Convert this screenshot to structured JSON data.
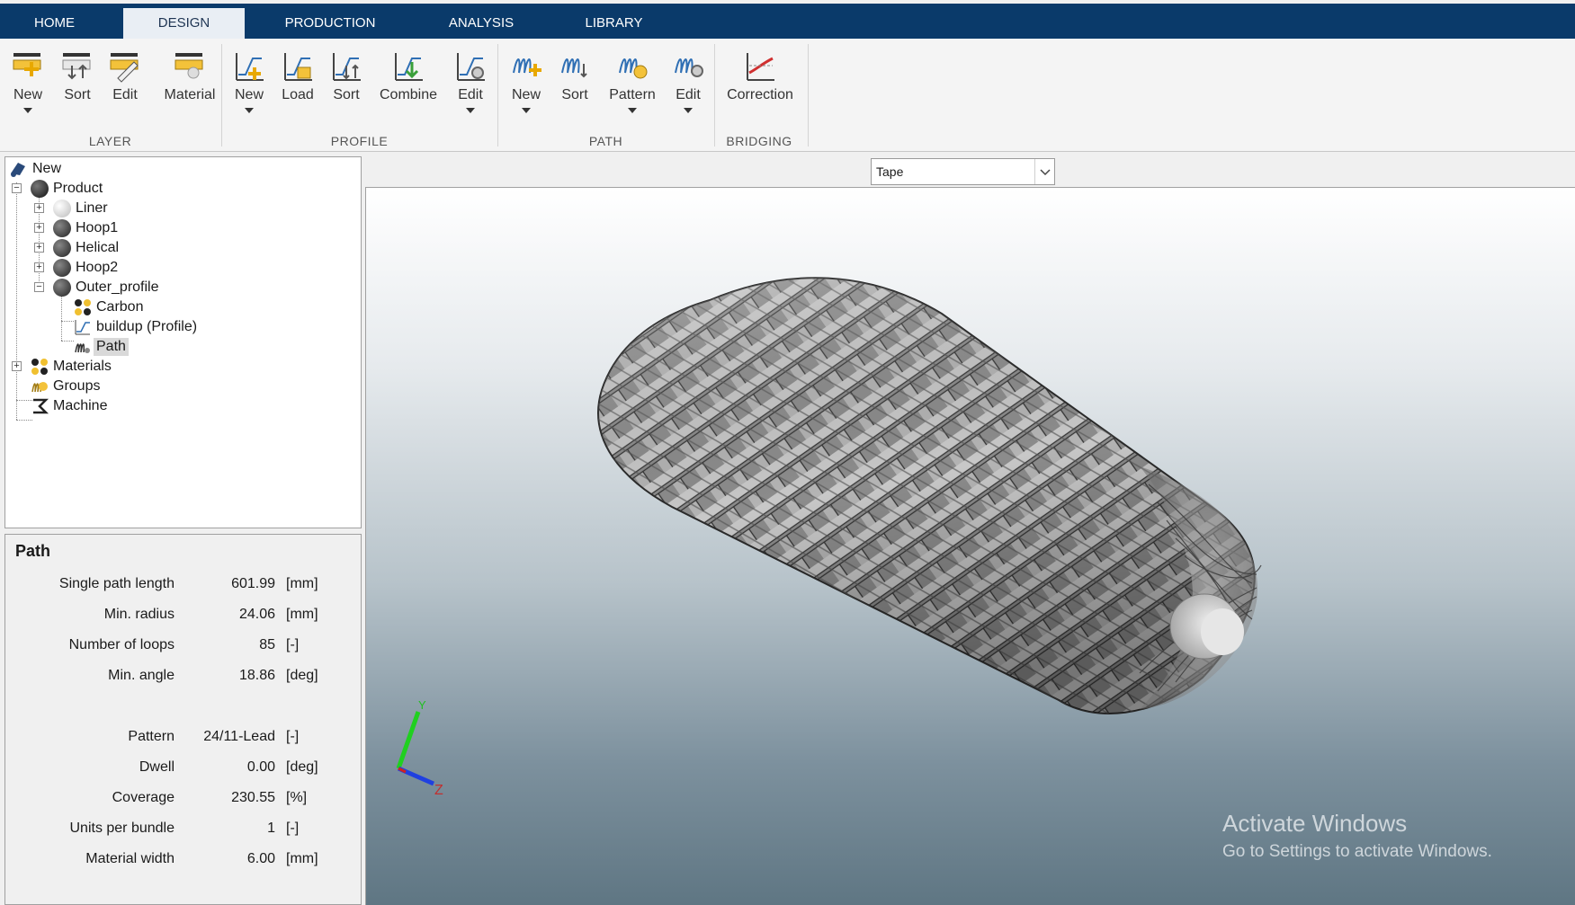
{
  "tabs": [
    "HOME",
    "DESIGN",
    "PRODUCTION",
    "ANALYSIS",
    "LIBRARY"
  ],
  "active_tab": "DESIGN",
  "ribbon": {
    "layer": {
      "group": "LAYER",
      "new": "New",
      "sort": "Sort",
      "edit": "Edit",
      "material": "Material"
    },
    "profile": {
      "group": "PROFILE",
      "new": "New",
      "load": "Load",
      "sort": "Sort",
      "combine": "Combine",
      "edit": "Edit"
    },
    "path": {
      "group": "PATH",
      "new": "New",
      "sort": "Sort",
      "pattern": "Pattern",
      "edit": "Edit"
    },
    "bridging": {
      "group": "BRIDGING",
      "correction": "Correction"
    }
  },
  "tree": {
    "root": "New",
    "product": "Product",
    "liner": "Liner",
    "hoop1": "Hoop1",
    "helical": "Helical",
    "hoop2": "Hoop2",
    "outer_profile": "Outer_profile",
    "carbon": "Carbon",
    "buildup": "buildup (Profile)",
    "path": "Path",
    "materials": "Materials",
    "groups": "Groups",
    "machine": "Machine"
  },
  "properties": {
    "title": "Path",
    "single_path_length": {
      "label": "Single path length",
      "value": "601.99",
      "unit": "[mm]"
    },
    "min_radius": {
      "label": "Min. radius",
      "value": "24.06",
      "unit": "[mm]"
    },
    "number_of_loops": {
      "label": "Number of loops",
      "value": "85",
      "unit": "[-]"
    },
    "min_angle": {
      "label": "Min. angle",
      "value": "18.86",
      "unit": "[deg]"
    },
    "pattern": {
      "label": "Pattern",
      "value": "24/11-Lead",
      "unit": "[-]"
    },
    "dwell": {
      "label": "Dwell",
      "value": "0.00",
      "unit": "[deg]"
    },
    "coverage": {
      "label": "Coverage",
      "value": "230.55",
      "unit": "[%]"
    },
    "units_per_bundle": {
      "label": "Units per bundle",
      "value": "1",
      "unit": "[-]"
    },
    "material_width": {
      "label": "Material width",
      "value": "6.00",
      "unit": "[mm]"
    }
  },
  "view": {
    "display_mode": "Tape",
    "axis_y": "Y",
    "axis_z": "Z"
  },
  "watermark": {
    "line1": "Activate Windows",
    "line2": "Go to Settings to activate Windows."
  },
  "colors": {
    "tabbar": "#0a3a6a",
    "accent": "#2f6fb4",
    "selection": "#d9d9d9"
  }
}
